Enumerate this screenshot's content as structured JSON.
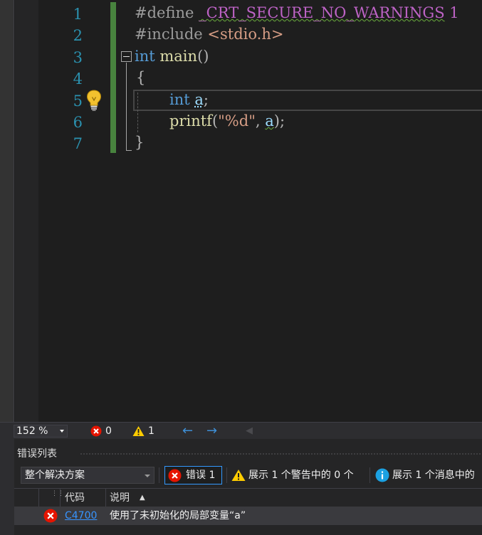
{
  "editor": {
    "line_numbers": [
      "1",
      "2",
      "3",
      "4",
      "5",
      "6",
      "7"
    ],
    "lines": {
      "l1": {
        "pre": "#define",
        "macro": "_CRT_SECURE_NO_WARNINGS",
        "value": "1"
      },
      "l2": {
        "pre": "#include",
        "header": "<stdio.h>"
      },
      "l3": {
        "type": "int",
        "fn": "main",
        "parens": "()"
      },
      "l4": {
        "brace": "{"
      },
      "l5": {
        "type": "int",
        "var": "a",
        "end": ";"
      },
      "l6": {
        "fn": "printf",
        "open": "(",
        "str": "\"%d\"",
        "comma": ", ",
        "var": "a",
        "close": ");"
      },
      "l7": {
        "brace": "}"
      }
    }
  },
  "status_bar": {
    "zoom": "152 %",
    "error_count": "0",
    "warning_count": "1"
  },
  "error_list": {
    "title": "错误列表",
    "scope": "整个解决方案",
    "errors_filter": "错误 1",
    "warnings_filter": "展示 1 个警告中的 0 个",
    "messages_filter": "展示 1 个消息中的",
    "columns": {
      "code": "代码",
      "description": "说明"
    },
    "rows": [
      {
        "code": "C4700",
        "description": "使用了未初始化的局部变量“a”"
      }
    ]
  },
  "colors": {
    "background": "#1e1e1e",
    "line_number": "#2b91af",
    "keyword": "#569cd6",
    "macro": "#bd63c5",
    "string": "#d69d85",
    "function": "#dcdcaa",
    "variable": "#9cdcfe",
    "change_bar": "#57a64a",
    "error_red": "#e51400",
    "warning_yellow": "#ffcc00",
    "info_blue": "#1ba1e2",
    "link": "#3794ff"
  }
}
